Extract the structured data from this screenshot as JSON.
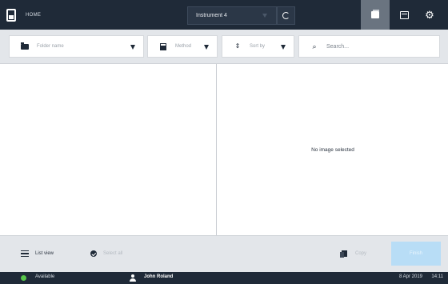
{
  "topbar": {
    "home_label": "HOME",
    "instrument": "Instrument 4",
    "icons": {
      "home": "home-icon",
      "refresh": "refresh-icon",
      "cards": "cards-icon",
      "panel": "panel-icon",
      "settings": "gear-icon"
    }
  },
  "filters": {
    "folder_placeholder": "Folder name",
    "method_placeholder": "Method",
    "sort_placeholder": "Sort by",
    "search_placeholder": "Search..."
  },
  "preview": {
    "empty_message": "No image selected"
  },
  "bottombar": {
    "list_view_label": "List view",
    "select_all_label": "Select all",
    "copy_label": "Copy",
    "primary_label": "Finish"
  },
  "status": {
    "state": "Available",
    "user": "John Roland",
    "date": "8 Apr 2019",
    "time": "14:11"
  },
  "colors": {
    "topbar_bg": "#1f2a38",
    "active_tab": "#6a7480",
    "available_dot": "#58c64a",
    "primary_disabled": "#b8ddf6"
  }
}
